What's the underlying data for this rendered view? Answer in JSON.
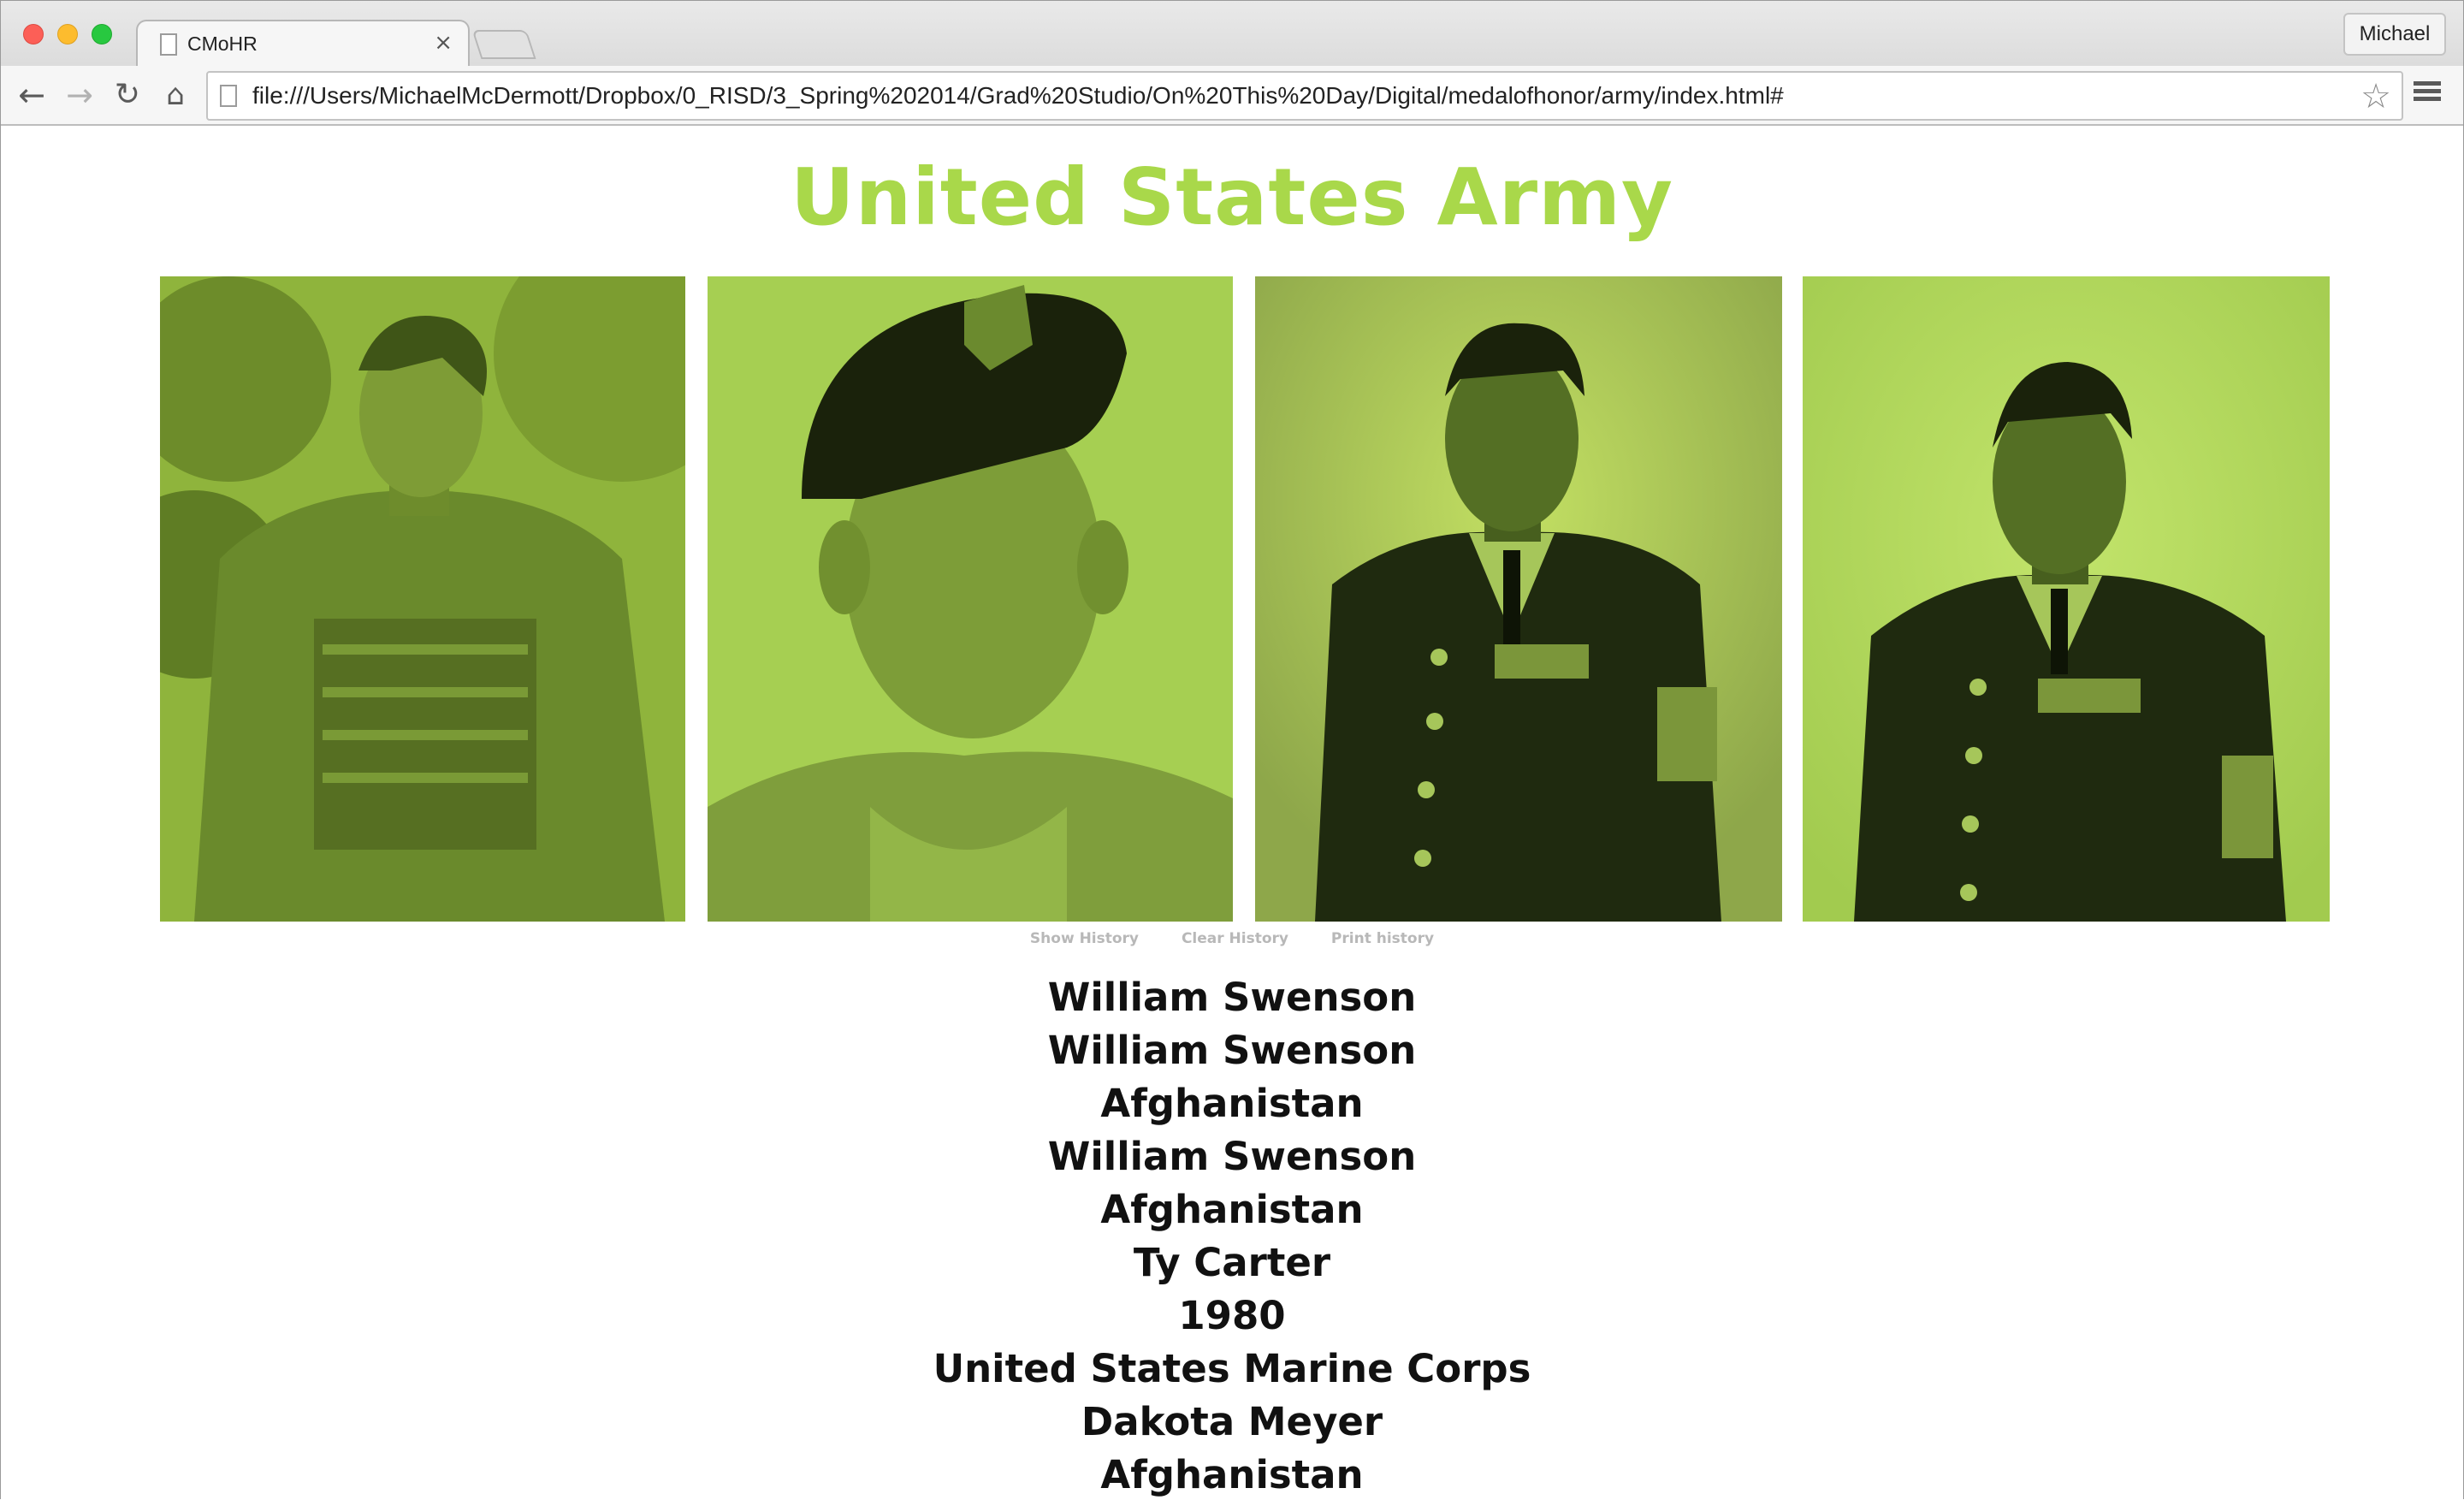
{
  "browser": {
    "tab_title": "CMoHR",
    "tab_close": "×",
    "profile_name": "Michael",
    "url": "file:///Users/MichaelMcDermott/Dropbox/0_RISD/3_Spring%202014/Grad%20Studio/On%20This%20Day/Digital/medalofhonor/army/index.html#",
    "icons": {
      "back": "←",
      "forward": "→",
      "reload": "↻",
      "home": "⌂",
      "star": "☆"
    }
  },
  "page": {
    "title": "United States Army",
    "accent_color": "#a9d84a",
    "photos": [
      {
        "icon": "soldier-portrait-camo"
      },
      {
        "icon": "soldier-portrait-beret"
      },
      {
        "icon": "soldier-portrait-dress-uniform"
      },
      {
        "icon": "soldier-portrait-dress-uniform"
      }
    ],
    "history_links": [
      "Show History",
      "Clear History",
      "Print history"
    ],
    "history_items": [
      "William Swenson",
      "William Swenson",
      "Afghanistan",
      "William Swenson",
      "Afghanistan",
      "Ty Carter",
      "1980",
      "United States Marine Corps",
      "Dakota Meyer",
      "Afghanistan"
    ]
  }
}
